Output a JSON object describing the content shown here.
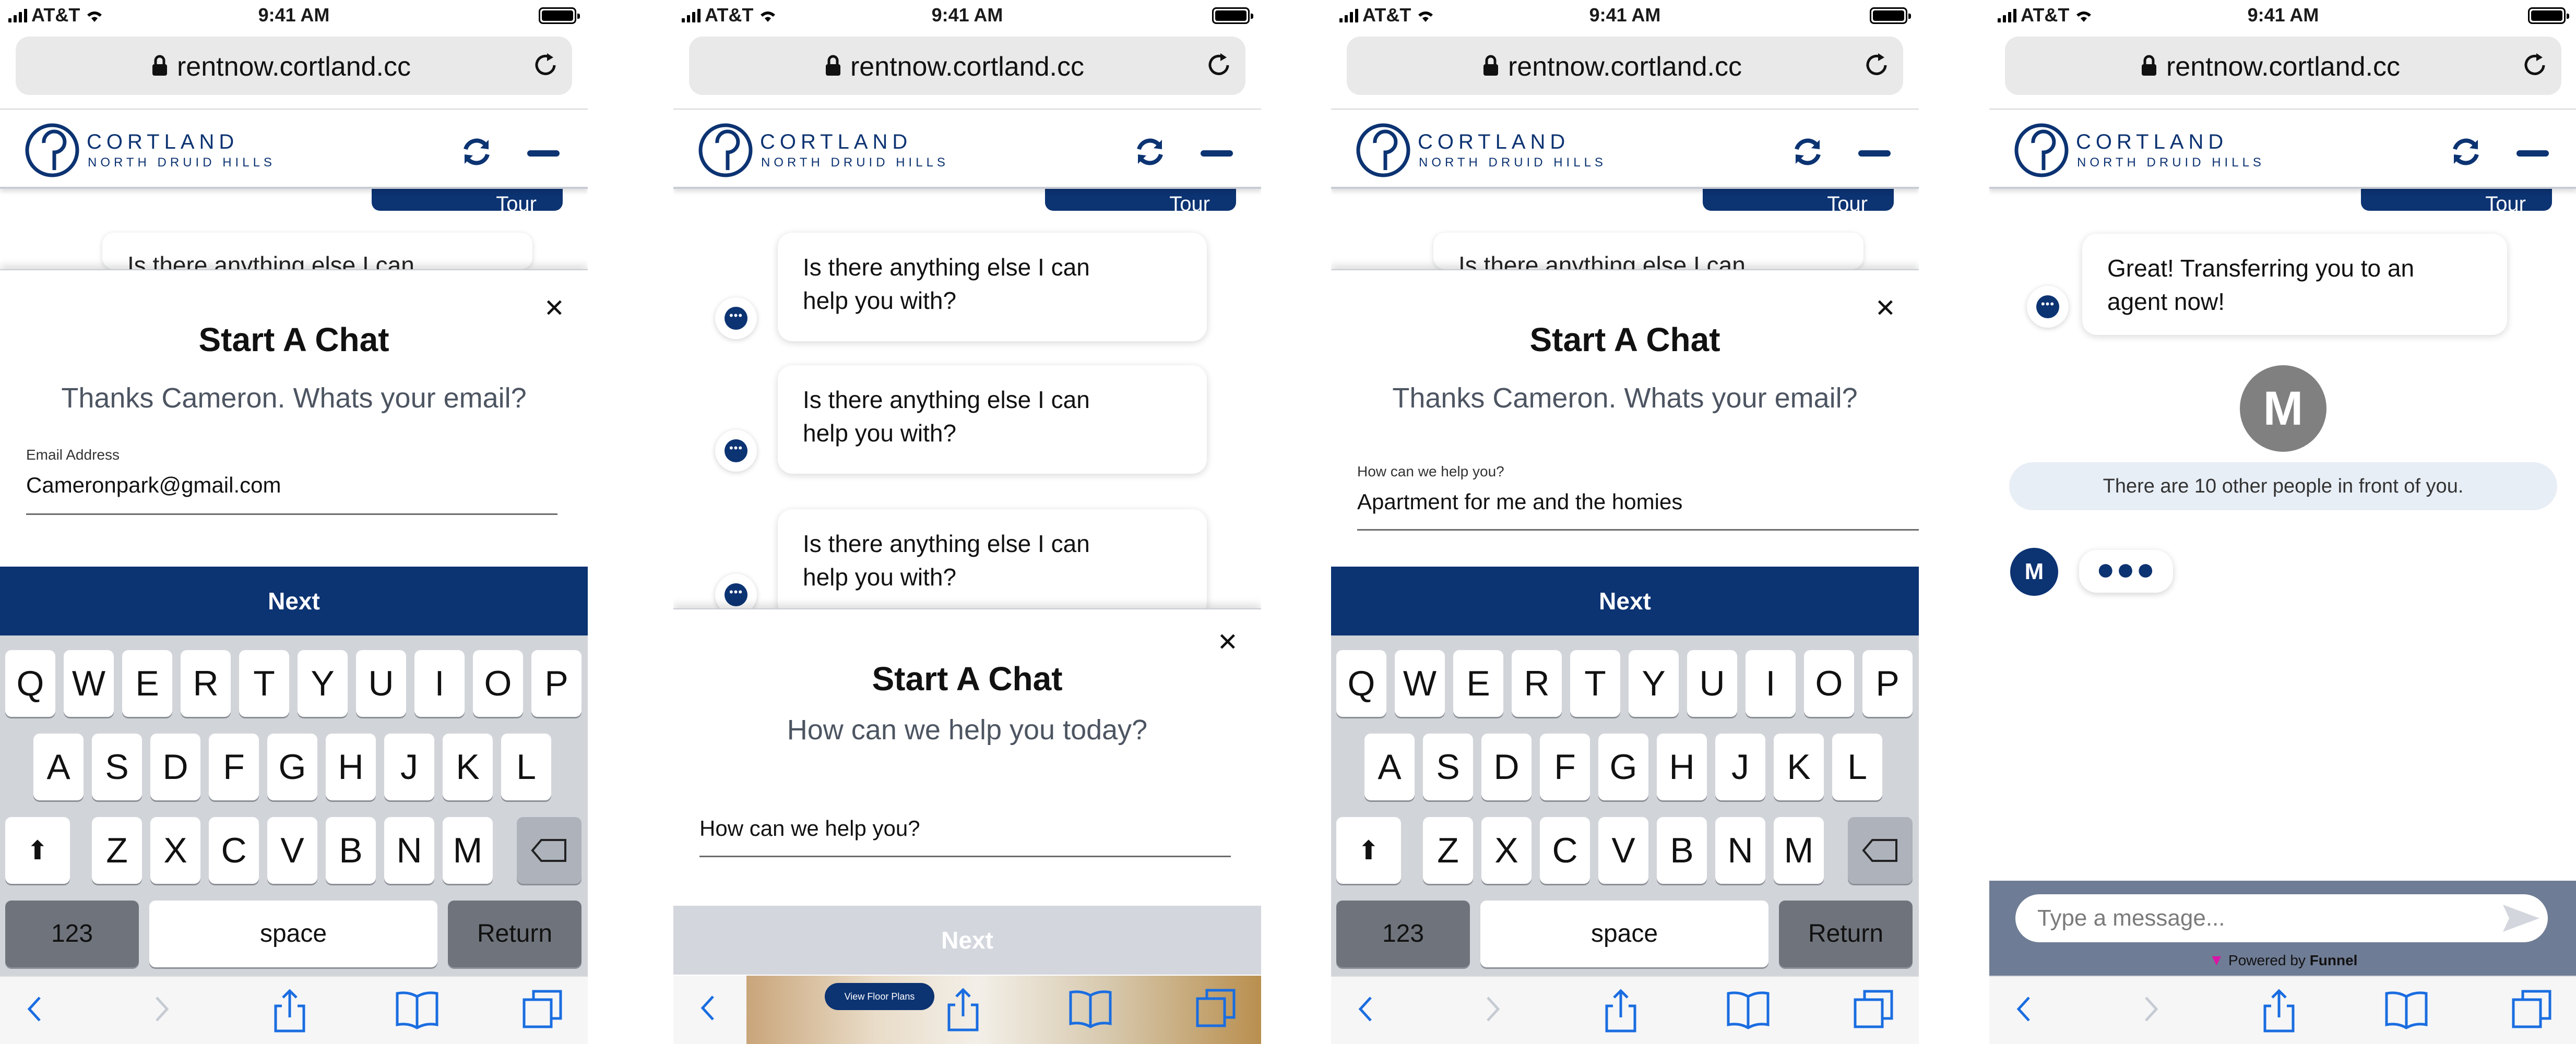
{
  "status": {
    "carrier": "AT&T",
    "time": "9:41 AM"
  },
  "browser": {
    "url": "rentnow.cortland.cc"
  },
  "brand": {
    "name": "CORTLAND",
    "subtitle": "NORTH DRUID HILLS"
  },
  "peek": {
    "tour_label": "Tour",
    "bubble_text": "Is there anything else I can"
  },
  "screen1": {
    "modal_title": "Start A Chat",
    "modal_subtitle": "Thanks Cameron. Whats your email?",
    "field_label": "Email Address",
    "field_value": "Cameronpark@gmail.com",
    "next_label": "Next"
  },
  "screen2": {
    "bubbles": [
      {
        "line1": "Is there anything else I can",
        "line2": "help you with?"
      },
      {
        "line1": "Is there anything else I can",
        "line2": "help you with?"
      },
      {
        "line1": "Is there anything else I can",
        "line2": "help you with?"
      }
    ],
    "modal_title": "Start A Chat",
    "modal_subtitle": "How can we help you today?",
    "field_value": "How can we help you?",
    "next_label": "Next",
    "floor_plans_label": "View Floor Plans"
  },
  "screen3": {
    "modal_title": "Start A Chat",
    "modal_subtitle": "Thanks Cameron. Whats your email?",
    "field_label": "How can we help you?",
    "field_value": "Apartment for me and the homies",
    "next_label": "Next"
  },
  "screen4": {
    "bubble_line1": "Great! Transferring you to an",
    "bubble_line2": "agent now!",
    "avatar_initial": "M",
    "queue_text": "There are 10 other people in front of you.",
    "agent_initial": "M",
    "typing": "●●●",
    "input_placeholder": "Type a message...",
    "powered_prefix": "Powered by",
    "powered_brand": "Funnel"
  },
  "keyboard": {
    "row1": [
      "Q",
      "W",
      "E",
      "R",
      "T",
      "Y",
      "U",
      "I",
      "O",
      "P"
    ],
    "row2": [
      "A",
      "S",
      "D",
      "F",
      "G",
      "H",
      "J",
      "K",
      "L"
    ],
    "row3": [
      "Z",
      "X",
      "C",
      "V",
      "B",
      "N",
      "M"
    ],
    "numbers": "123",
    "space": "space",
    "return": "Return"
  },
  "colors": {
    "brand_navy": "#0c3372",
    "keyboard_bg": "#d1d4d9",
    "disabled": "#d3d6dd"
  },
  "icons": [
    "lock-icon",
    "reload-icon",
    "refresh-icon",
    "minimize-icon",
    "close-icon",
    "chat-bot-icon",
    "shift-icon",
    "backspace-icon",
    "back-icon",
    "forward-icon",
    "share-icon",
    "bookmarks-icon",
    "tabs-icon",
    "send-icon"
  ]
}
